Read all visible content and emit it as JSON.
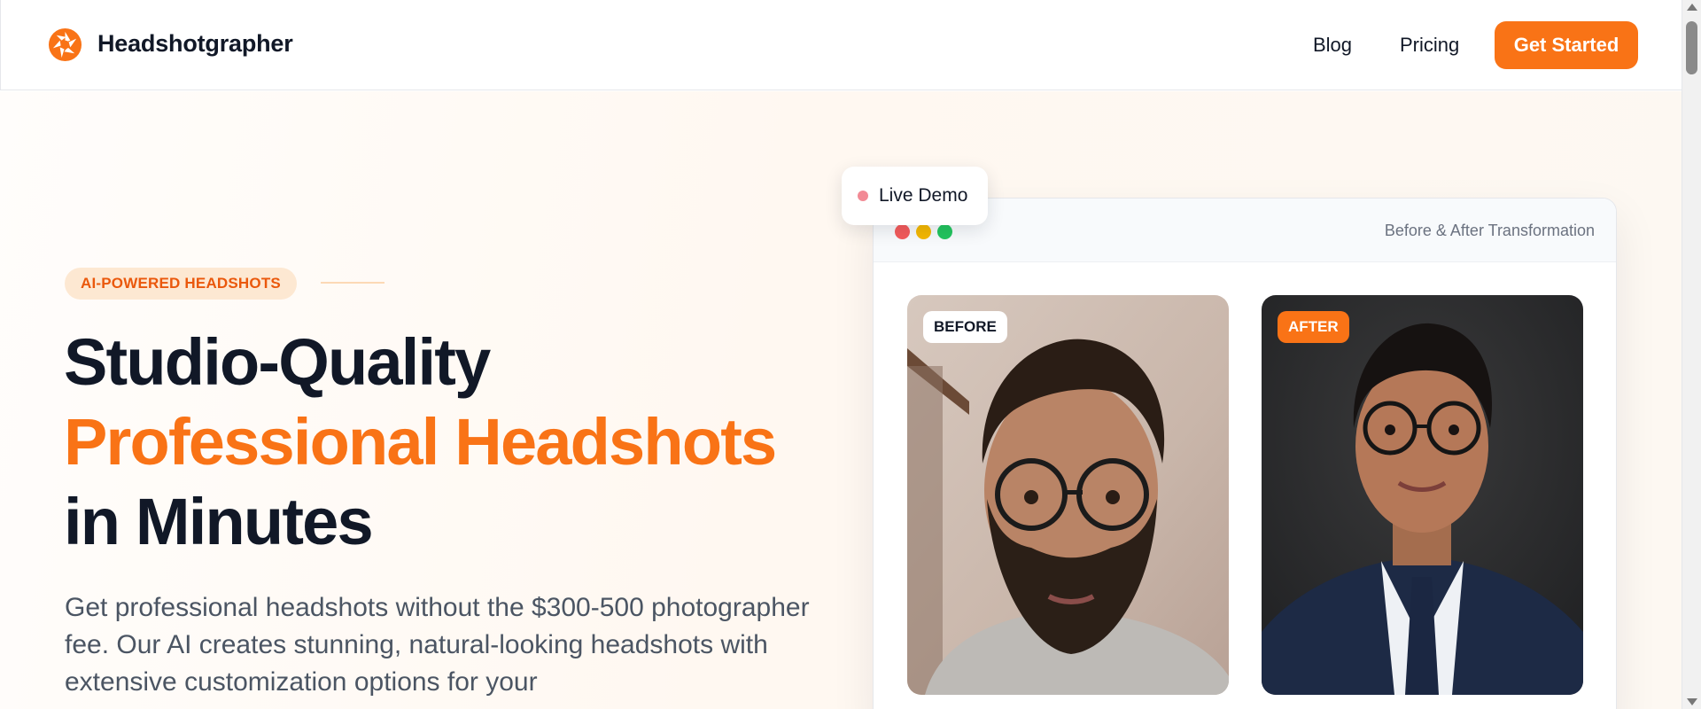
{
  "header": {
    "brand": "Headshotgrapher",
    "logo_icon": "aperture-icon",
    "nav": {
      "blog": "Blog",
      "pricing": "Pricing"
    },
    "cta": "Get Started"
  },
  "hero": {
    "badge": "AI-POWERED HEADSHOTS",
    "headline_line1": "Studio-Quality",
    "headline_line2": "Professional Headshots",
    "headline_line3": "in Minutes",
    "subtext": "Get professional headshots without the $300-500 photographer fee. Our AI creates stunning, natural-looking headshots with extensive customization options for your"
  },
  "demo": {
    "pill": "Live Demo",
    "window_title": "Before & After Transformation",
    "before_label": "BEFORE",
    "after_label": "AFTER"
  },
  "colors": {
    "accent": "#f97316",
    "heading": "#111827",
    "body_text": "#4b5563"
  }
}
